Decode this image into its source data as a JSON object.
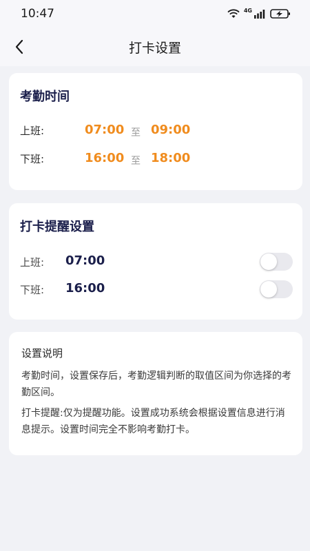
{
  "status_bar": {
    "time": "10:47",
    "network": "4G"
  },
  "nav": {
    "title": "打卡设置"
  },
  "work_hours": {
    "title": "考勤时间",
    "rows": [
      {
        "label": "上班:",
        "start": "07:00",
        "sep": "至",
        "end": "09:00"
      },
      {
        "label": "下班:",
        "start": "16:00",
        "sep": "至",
        "end": "18:00"
      }
    ]
  },
  "reminder": {
    "title": "打卡提醒设置",
    "rows": [
      {
        "label": "上班:",
        "time": "07:00",
        "enabled": false
      },
      {
        "label": "下班:",
        "time": "16:00",
        "enabled": false
      }
    ]
  },
  "info": {
    "title": "设置说明",
    "paragraphs": [
      "考勤时间，设置保存后，考勤逻辑判断的取值区间为你选择的考勤区间。",
      "打卡提醒:仅为提醒功能。设置成功系统会根据设置信息进行消息提示。设置时间完全不影响考勤打卡。"
    ]
  },
  "colors": {
    "accent_orange": "#f08c1e",
    "navy": "#1b1f4b",
    "background": "#f1f2f6"
  }
}
